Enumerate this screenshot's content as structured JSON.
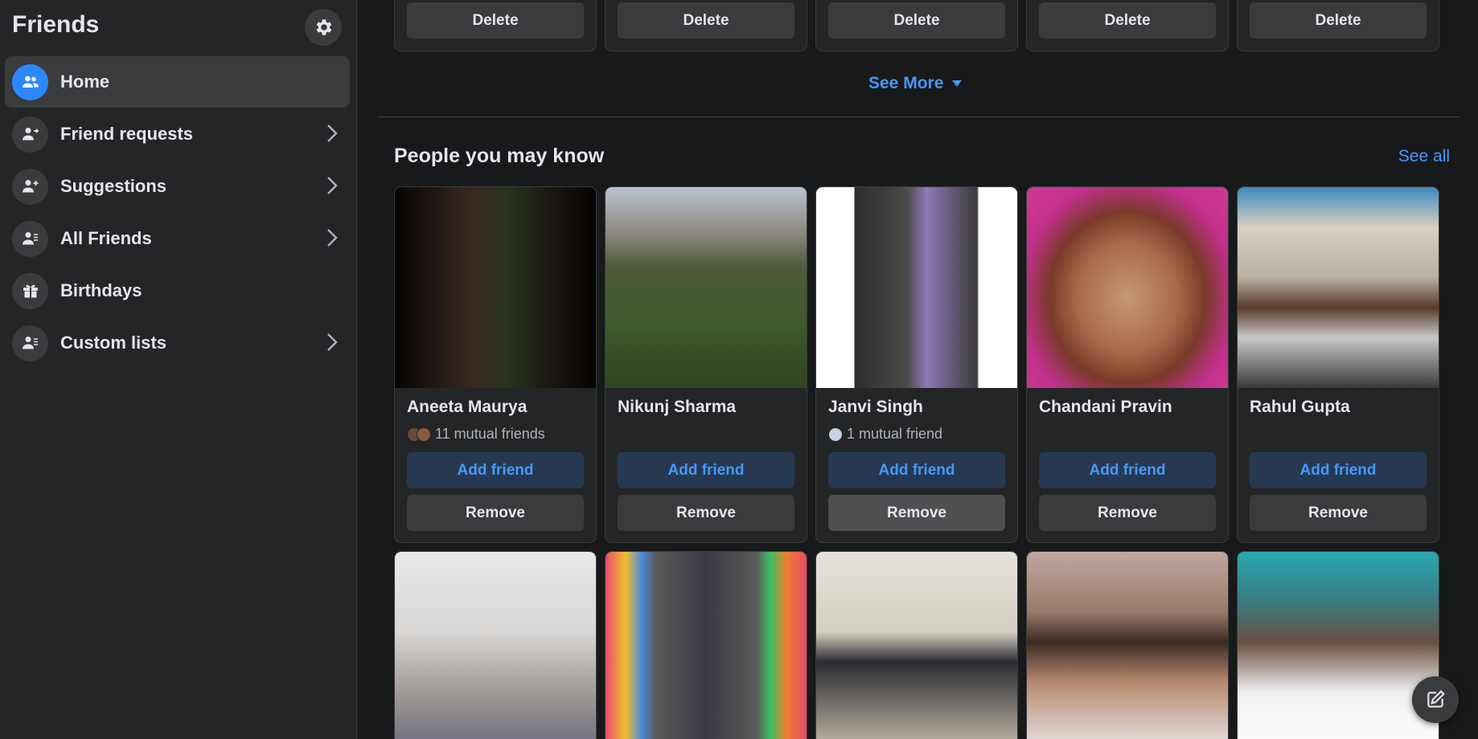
{
  "sidebar": {
    "title": "Friends",
    "items": [
      {
        "label": "Home",
        "icon": "people-icon"
      },
      {
        "label": "Friend requests",
        "icon": "person-arrow-icon"
      },
      {
        "label": "Suggestions",
        "icon": "person-add-icon"
      },
      {
        "label": "All Friends",
        "icon": "person-list-icon"
      },
      {
        "label": "Birthdays",
        "icon": "gift-icon"
      },
      {
        "label": "Custom lists",
        "icon": "person-list-icon"
      }
    ]
  },
  "requests": {
    "delete_label": "Delete",
    "see_more_label": "See More"
  },
  "pymk": {
    "title": "People you may know",
    "see_all_label": "See all",
    "add_label": "Add friend",
    "remove_label": "Remove",
    "people": [
      {
        "name": "Aneeta Maurya",
        "mutual": "11 mutual friends"
      },
      {
        "name": "Nikunj Sharma",
        "mutual": ""
      },
      {
        "name": "Janvi Singh",
        "mutual": "1 mutual friend"
      },
      {
        "name": "Chandani Pravin",
        "mutual": ""
      },
      {
        "name": "Rahul Gupta",
        "mutual": ""
      }
    ]
  },
  "colors": {
    "accent": "#2d88ff",
    "link": "#4599ff",
    "background": "#18191a",
    "surface": "#242526"
  }
}
